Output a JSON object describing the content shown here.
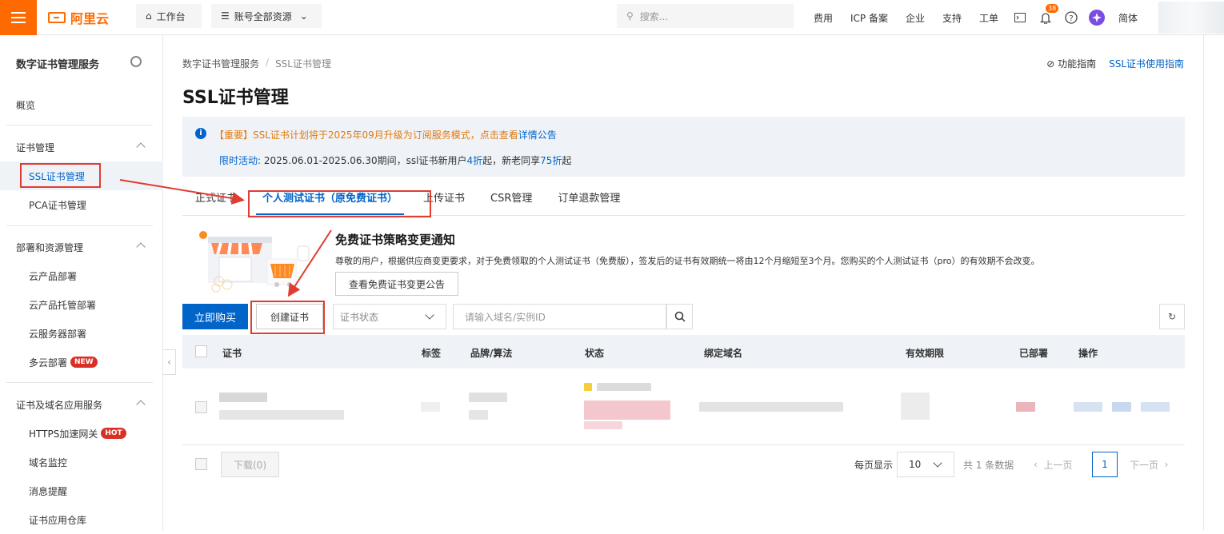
{
  "topbar": {
    "logo_text": "阿里云",
    "workbench": "工作台",
    "account_scope": "账号全部资源",
    "search_placeholder": "搜索...",
    "links": [
      "费用",
      "ICP 备案",
      "企业",
      "支持",
      "工单"
    ],
    "notification_count": "38",
    "language": "简体"
  },
  "sidebar": {
    "title": "数字证书管理服务",
    "overview": "概览",
    "groups": [
      {
        "label": "证书管理",
        "items": [
          "SSL证书管理",
          "PCA证书管理"
        ]
      },
      {
        "label": "部署和资源管理",
        "items": [
          "云产品部署",
          "云产品托管部署",
          "云服务器部署",
          "多云部署"
        ]
      },
      {
        "label": "证书及域名应用服务",
        "items": [
          "HTTPS加速网关",
          "域名监控",
          "消息提醒",
          "证书应用仓库"
        ]
      }
    ],
    "tag_new": "NEW",
    "tag_hot": "HOT"
  },
  "main": {
    "breadcrumb": [
      "数字证书管理服务",
      "SSL证书管理"
    ],
    "help_feature": "功能指南",
    "help_guide": "SSL证书使用指南",
    "title": "SSL证书管理",
    "notice": {
      "line1_prefix": "【重要】SSL证书计划将于2025年09月升级为订阅服务模式，点击查看",
      "line1_link": "详情公告",
      "line2_a": "限时活动:",
      "line2_b": "2025.06.01-2025.06.30期间，ssl证书新用户",
      "line2_c": "4折",
      "line2_d": "起，新老同享",
      "line2_e": "75折",
      "line2_f": "起"
    },
    "tabs": [
      "正式证书",
      "个人测试证书（原免费证书）",
      "上传证书",
      "CSR管理",
      "订单退款管理"
    ],
    "promo": {
      "title": "免费证书策略变更通知",
      "text": "尊敬的用户，根据供应商变更要求，对于免费领取的个人测试证书（免费版），签发后的证书有效期统一将由12个月缩短至3个月。您购买的个人测试证书（pro）的有效期不会改变。",
      "button": "查看免费证书变更公告"
    },
    "toolbar": {
      "buy": "立即购买",
      "create": "创建证书",
      "status_placeholder": "证书状态",
      "search_placeholder": "请输入域名/实例ID"
    },
    "table": {
      "columns": [
        "证书",
        "标签",
        "品牌/算法",
        "状态",
        "绑定域名",
        "有效期限",
        "已部署",
        "操作"
      ]
    },
    "footer": {
      "download": "下载(0)",
      "per_page_label": "每页显示",
      "per_page": "10",
      "total": "共 1 条数据",
      "prev": "上一页",
      "page": "1",
      "next": "下一页"
    }
  }
}
